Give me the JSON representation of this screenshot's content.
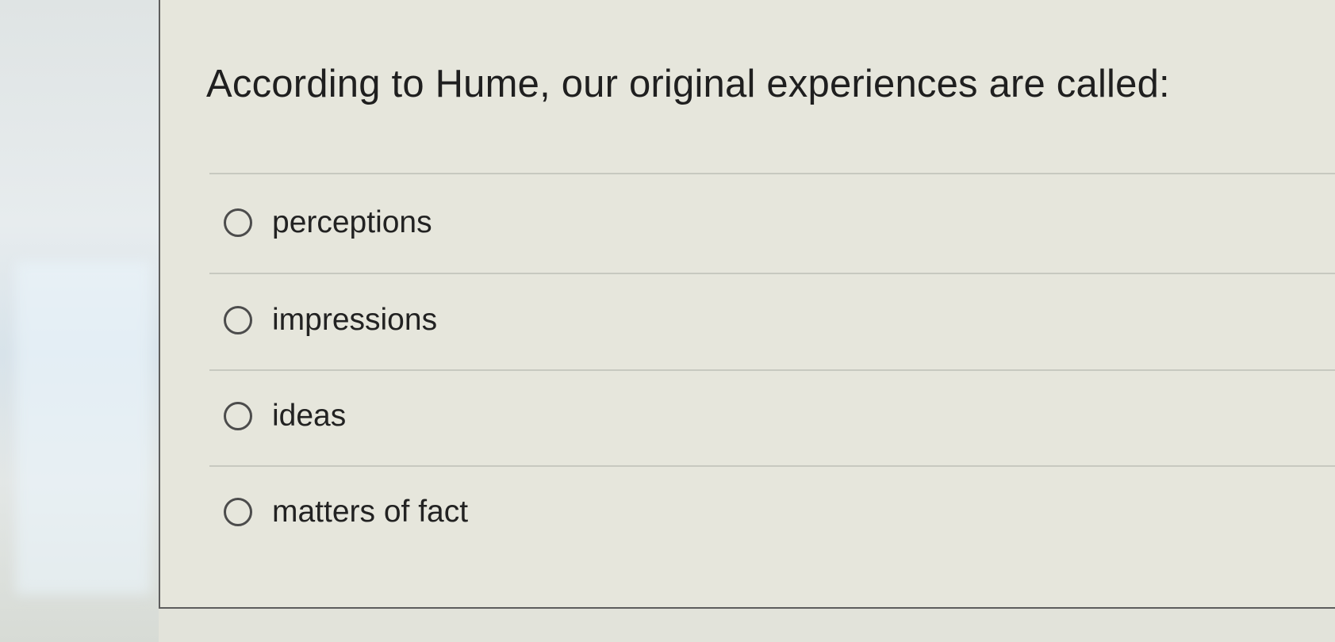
{
  "question": {
    "text": "According to Hume, our original experiences are called:"
  },
  "answers": [
    {
      "label": "perceptions"
    },
    {
      "label": "impressions"
    },
    {
      "label": "ideas"
    },
    {
      "label": "matters of fact"
    }
  ],
  "icons": {
    "radio": "radio-unchecked-icon"
  },
  "colors": {
    "panel_background": "#e6e6dc",
    "text": "#1f1f1f",
    "divider": "#c7c9c0"
  }
}
